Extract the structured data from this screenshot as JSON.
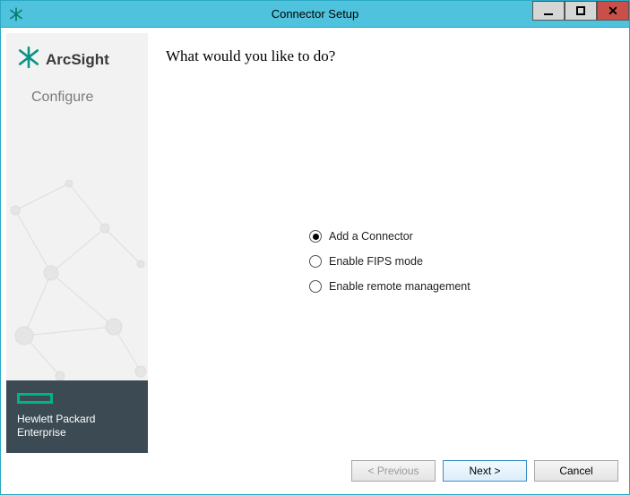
{
  "titlebar": {
    "title": "Connector Setup"
  },
  "sidebar": {
    "brand_name": "ArcSight",
    "subtitle": "Configure",
    "footer_line1": "Hewlett Packard",
    "footer_line2": "Enterprise"
  },
  "main": {
    "question": "What would you like to do?",
    "options": [
      {
        "label": "Add a Connector",
        "selected": true
      },
      {
        "label": "Enable FIPS mode",
        "selected": false
      },
      {
        "label": "Enable remote management",
        "selected": false
      }
    ]
  },
  "buttons": {
    "previous": "< Previous",
    "next": "Next >",
    "cancel": "Cancel"
  }
}
